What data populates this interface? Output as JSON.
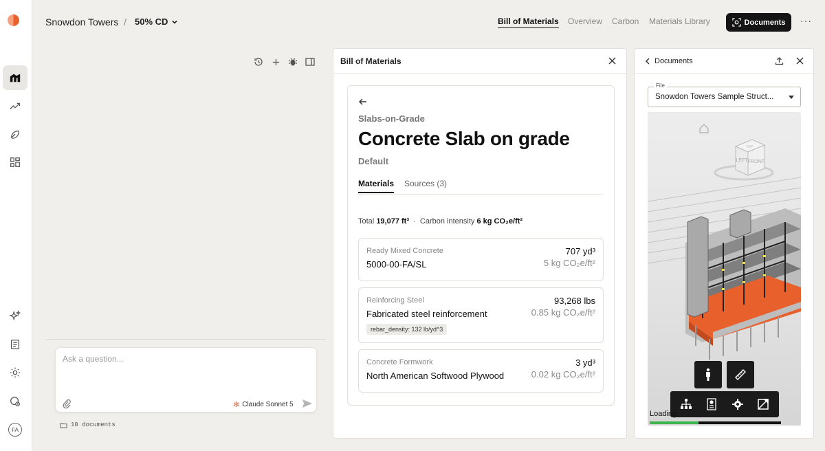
{
  "app": {
    "breadcrumb": {
      "project": "Snowdon Towers",
      "separator": "/",
      "phase": "50% CD"
    },
    "nav": [
      "Bill of Materials",
      "Overview",
      "Carbon",
      "Materials Library"
    ],
    "documents_button": "Documents",
    "more": "···"
  },
  "sidebar": {
    "icons": [
      "home-icon",
      "trend-icon",
      "leaf-icon",
      "dashboard-icon",
      "sparkles-icon",
      "document-icon",
      "settings-icon",
      "globe-icon"
    ],
    "avatar_initials": "FA"
  },
  "chat": {
    "placeholder": "Ask a question...",
    "model": "Claude Sonnet 5",
    "documents": "10 documents"
  },
  "bom": {
    "panel_title": "Bill of Materials",
    "category": "Slabs-on-Grade",
    "title": "Concrete Slab on grade",
    "variant": "Default",
    "tabs": [
      "Materials",
      "Sources (3)"
    ],
    "total_label": "Total",
    "total_value": "19,077 ft³",
    "intensity_label": "Carbon intensity",
    "intensity_value": "6 kg CO₂e/ft²",
    "materials": [
      {
        "category": "Ready Mixed Concrete",
        "name": "5000-00-FA/SL",
        "quantity": "707 yd³",
        "carbon": "5 kg CO₂e/ft²"
      },
      {
        "category": "Reinforcing Steel",
        "name": "Fabricated steel reinforcement",
        "quantity": "93,268 lbs",
        "carbon": "0.85 kg CO₂e/ft²",
        "tag": "rebar_density: 132 lb/yd^3"
      },
      {
        "category": "Concrete Formwork",
        "name": "North American Softwood Plywood",
        "quantity": "3 yd³",
        "carbon": "0.02 kg CO₂e/ft²"
      }
    ]
  },
  "documents": {
    "panel_title": "Documents",
    "file_label": "File",
    "file_value": "Snowdon Towers Sample Struct...",
    "viewcube": {
      "top": "TOP",
      "left": "LEFT",
      "front": "FRONT"
    },
    "loading_text": "Loading",
    "loading_progress": 0.37
  }
}
